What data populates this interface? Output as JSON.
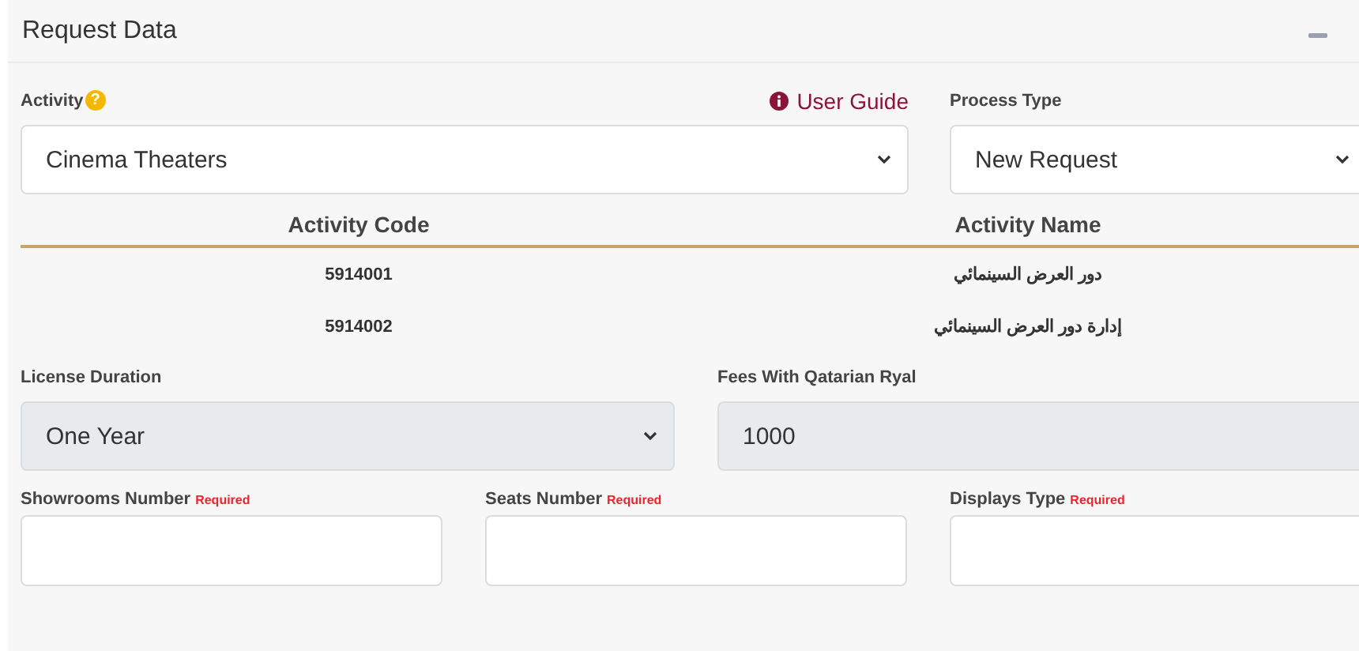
{
  "panel": {
    "title": "Request Data",
    "collapsed": false
  },
  "activity": {
    "label": "Activity",
    "help": "?",
    "user_guide": "User Guide",
    "value": "Cinema Theaters",
    "disabled": false
  },
  "process_type": {
    "label": "Process Type",
    "value": "New Request",
    "disabled": false
  },
  "table": {
    "columns": [
      "Activity Code",
      "Activity Name"
    ],
    "rows": [
      [
        "5914001",
        "دور العرض السينمائي"
      ],
      [
        "5914002",
        "إدارة دور العرض السينمائي"
      ]
    ]
  },
  "license_duration": {
    "label": "License Duration",
    "value": "One Year",
    "disabled": true
  },
  "fees": {
    "label": "Fees With Qatarian Ryal",
    "value": "1000",
    "disabled": true
  },
  "inputs": [
    {
      "label": "Showrooms Number",
      "required": true,
      "required_text": "Required"
    },
    {
      "label": "Seats Number",
      "required": true,
      "required_text": "Required"
    },
    {
      "label": "Displays Type",
      "required": true,
      "required_text": "Required"
    }
  ]
}
